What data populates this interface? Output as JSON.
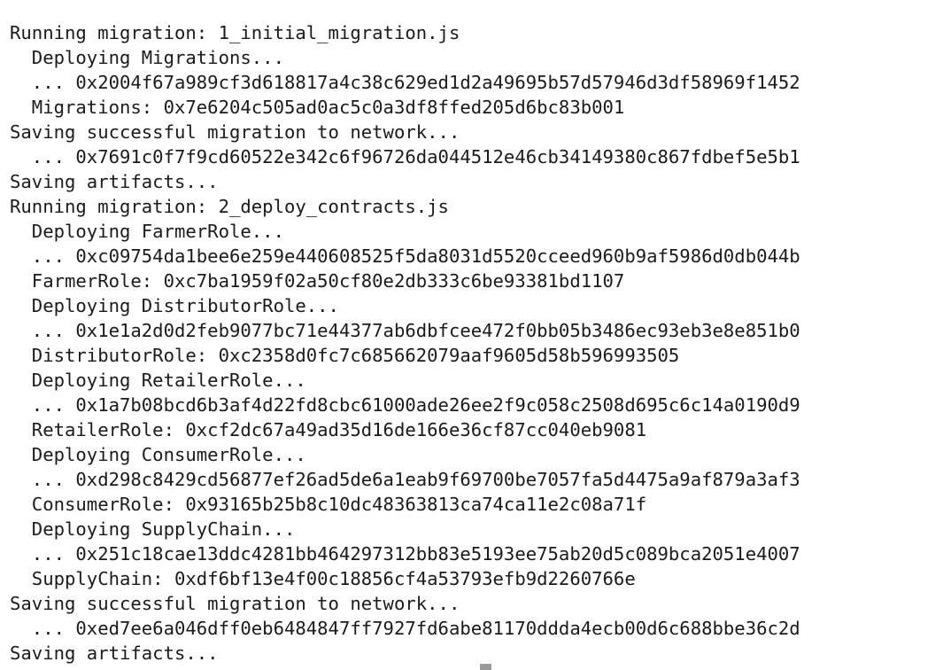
{
  "terminal": {
    "lines": [
      "Running migration: 1_initial_migration.js",
      "  Deploying Migrations...",
      "  ... 0x2004f67a989cf3d618817a4c38c629ed1d2a49695b57d57946d3df58969f1452",
      "  Migrations: 0x7e6204c505ad0ac5c0a3df8ffed205d6bc83b001",
      "Saving successful migration to network...",
      "  ... 0x7691c0f7f9cd60522e342c6f96726da044512e46cb34149380c867fdbef5e5b1",
      "Saving artifacts...",
      "Running migration: 2_deploy_contracts.js",
      "  Deploying FarmerRole...",
      "  ... 0xc09754da1bee6e259e440608525f5da8031d5520cceed960b9af5986d0db044b",
      "  FarmerRole: 0xc7ba1959f02a50cf80e2db333c6be93381bd1107",
      "  Deploying DistributorRole...",
      "  ... 0x1e1a2d0d2feb9077bc71e44377ab6dbfcee472f0bb05b3486ec93eb3e8e851b0",
      "  DistributorRole: 0xc2358d0fc7c685662079aaf9605d58b596993505",
      "  Deploying RetailerRole...",
      "  ... 0x1a7b08bcd6b3af4d22fd8cbc61000ade26ee2f9c058c2508d695c6c14a0190d9",
      "  RetailerRole: 0xcf2dc67a49ad35d16de166e36cf87cc040eb9081",
      "  Deploying ConsumerRole...",
      "  ... 0xd298c8429cd56877ef26ad5de6a1eab9f69700be7057fa5d4475a9af879a3af3",
      "  ConsumerRole: 0x93165b25b8c10dc48363813ca74ca11e2c08a71f",
      "  Deploying SupplyChain...",
      "  ... 0x251c18cae13ddc4281bb464297312bb83e5193ee75ab20d5c089bca2051e4007",
      "  SupplyChain: 0xdf6bf13e4f00c18856cf4a53793efb9d2260766e",
      "Saving successful migration to network...",
      "  ... 0xed7ee6a046dff0eb6484847ff7927fd6abe81170ddda4ecb00d6c688bbe36c2d",
      "Saving artifacts..."
    ]
  }
}
